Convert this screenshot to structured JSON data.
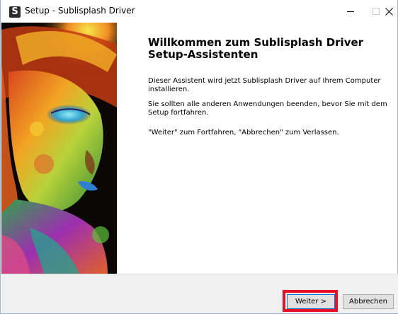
{
  "window": {
    "title": "Setup - Sublisplash Driver",
    "icon_letter": "S",
    "icon": "app-s-icon",
    "controls": [
      "minimize-icon",
      "maximize-icon",
      "close-icon"
    ]
  },
  "welcome": {
    "heading": "Willkommen zum Sublisplash Driver Setup-Assistenten",
    "paragraph1": "Dieser Assistent wird jetzt Sublisplash Driver auf Ihrem Computer installieren.",
    "paragraph2": "Sie sollten alle anderen Anwendungen beenden, bevor Sie mit dem Setup fortfahren.",
    "paragraph3": "\"Weiter\" zum Fortfahren, \"Abbrechen\" zum Verlassen."
  },
  "buttons": {
    "next_label": "Weiter >",
    "cancel_label": "Abbrechen"
  },
  "colors": {
    "highlight": "#e81123",
    "focus_border": "#0078d7",
    "button_face": "#e1e1e1",
    "bottom_bar": "#f0f0f0"
  }
}
